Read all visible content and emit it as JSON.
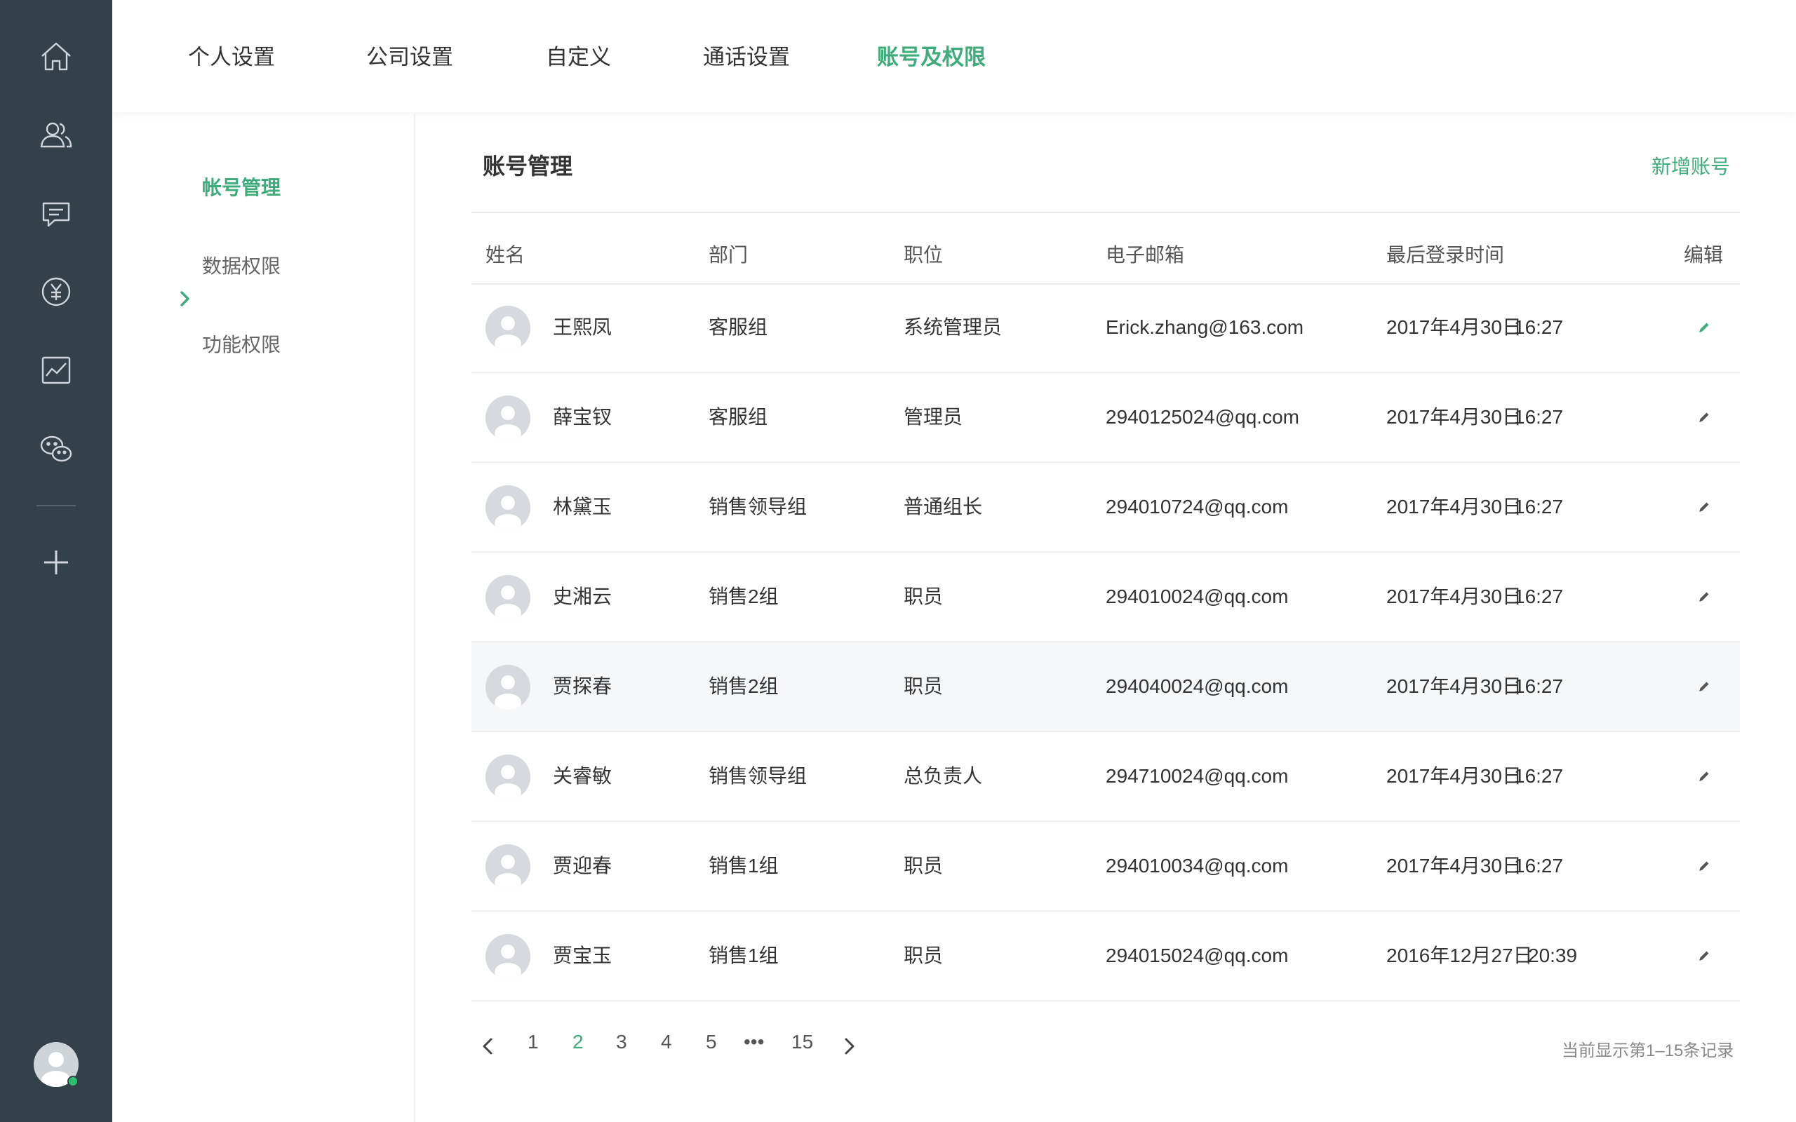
{
  "colors": {
    "accent": "#3dab7a",
    "rail": "#334149",
    "online": "#2fbf71"
  },
  "rail": {
    "icons": [
      "home-icon",
      "contacts-icon",
      "chat-icon",
      "yuan-icon",
      "chart-icon",
      "wechat-icon",
      "add-icon"
    ]
  },
  "topnav": {
    "tabs": [
      {
        "label": "个人设置",
        "active": false
      },
      {
        "label": "公司设置",
        "active": false
      },
      {
        "label": "自定义",
        "active": false
      },
      {
        "label": "通话设置",
        "active": false
      },
      {
        "label": "账号及权限",
        "active": true
      }
    ]
  },
  "subnav": {
    "items": [
      {
        "label": "帐号管理",
        "active": true
      },
      {
        "label": "数据权限",
        "active": false
      },
      {
        "label": "功能权限",
        "active": false
      }
    ]
  },
  "main": {
    "title": "账号管理",
    "add_label": "新增账号",
    "columns": [
      "姓名",
      "部门",
      "职位",
      "电子邮箱",
      "最后登录时间",
      "编辑"
    ],
    "rows": [
      {
        "name": "王熙凤",
        "dept": "客服组",
        "role": "系统管理员",
        "email": "Erick.zhang@163.com",
        "date": "2017年4月30日",
        "time": "16:27"
      },
      {
        "name": "薛宝钗",
        "dept": "客服组",
        "role": "管理员",
        "email": "2940125024@qq.com",
        "date": "2017年4月30日",
        "time": "16:27"
      },
      {
        "name": "林黛玉",
        "dept": "销售领导组",
        "role": "普通组长",
        "email": "294010724@qq.com",
        "date": "2017年4月30日",
        "time": "16:27"
      },
      {
        "name": "史湘云",
        "dept": "销售2组",
        "role": "职员",
        "email": "294010024@qq.com",
        "date": "2017年4月30日",
        "time": "16:27"
      },
      {
        "name": "贾探春",
        "dept": "销售2组",
        "role": "职员",
        "email": "294040024@qq.com",
        "date": "2017年4月30日",
        "time": "16:27"
      },
      {
        "name": "关睿敏",
        "dept": "销售领导组",
        "role": "总负责人",
        "email": "294710024@qq.com",
        "date": "2017年4月30日",
        "time": "16:27"
      },
      {
        "name": "贾迎春",
        "dept": "销售1组",
        "role": "职员",
        "email": "294010034@qq.com",
        "date": "2017年4月30日",
        "time": "16:27"
      },
      {
        "name": "贾宝玉",
        "dept": "销售1组",
        "role": "职员",
        "email": "294015024@qq.com",
        "date": "2016年12月27日",
        "time": "20:39"
      }
    ]
  },
  "pagination": {
    "pages": [
      "1",
      "2",
      "3",
      "4",
      "5",
      "•••",
      "15"
    ],
    "current": "2",
    "info": "当前显示第1–15条记录"
  }
}
